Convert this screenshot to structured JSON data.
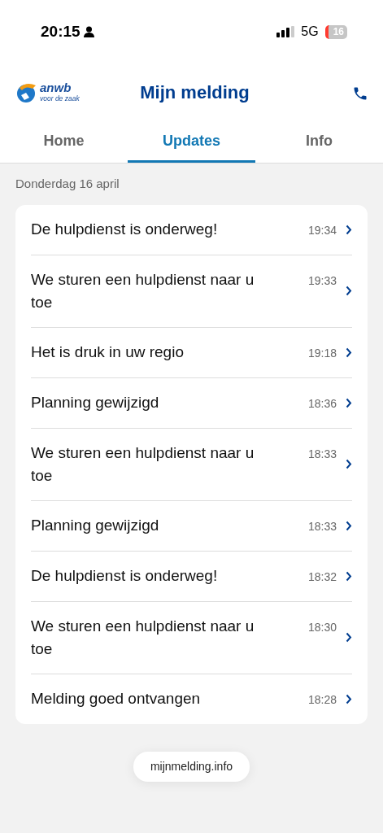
{
  "status_bar": {
    "time": "20:15",
    "network": "5G",
    "battery": "16"
  },
  "header": {
    "logo": {
      "wordmark": "anwb",
      "tagline": "voor de zaak"
    },
    "title": "Mijn melding"
  },
  "tabs": [
    {
      "label": "Home",
      "selected": false
    },
    {
      "label": "Updates",
      "selected": true
    },
    {
      "label": "Info",
      "selected": false
    }
  ],
  "date": "Donderdag 16 april",
  "updates": [
    {
      "title": "De hulpdienst is onderweg!",
      "time": "19:34"
    },
    {
      "title": "We sturen een hulpdienst naar u toe",
      "time": "19:33"
    },
    {
      "title": "Het is druk in uw regio",
      "time": "19:18"
    },
    {
      "title": "Planning gewijzigd",
      "time": "18:36"
    },
    {
      "title": "We sturen een hulpdienst naar u toe",
      "time": "18:33"
    },
    {
      "title": "Planning gewijzigd",
      "time": "18:33"
    },
    {
      "title": "De hulpdienst is onderweg!",
      "time": "18:32"
    },
    {
      "title": "We sturen een hulpdienst naar u toe",
      "time": "18:30"
    },
    {
      "title": "Melding goed ontvangen",
      "time": "18:28"
    }
  ],
  "url_bar": {
    "url": "mijnmelding.info"
  }
}
